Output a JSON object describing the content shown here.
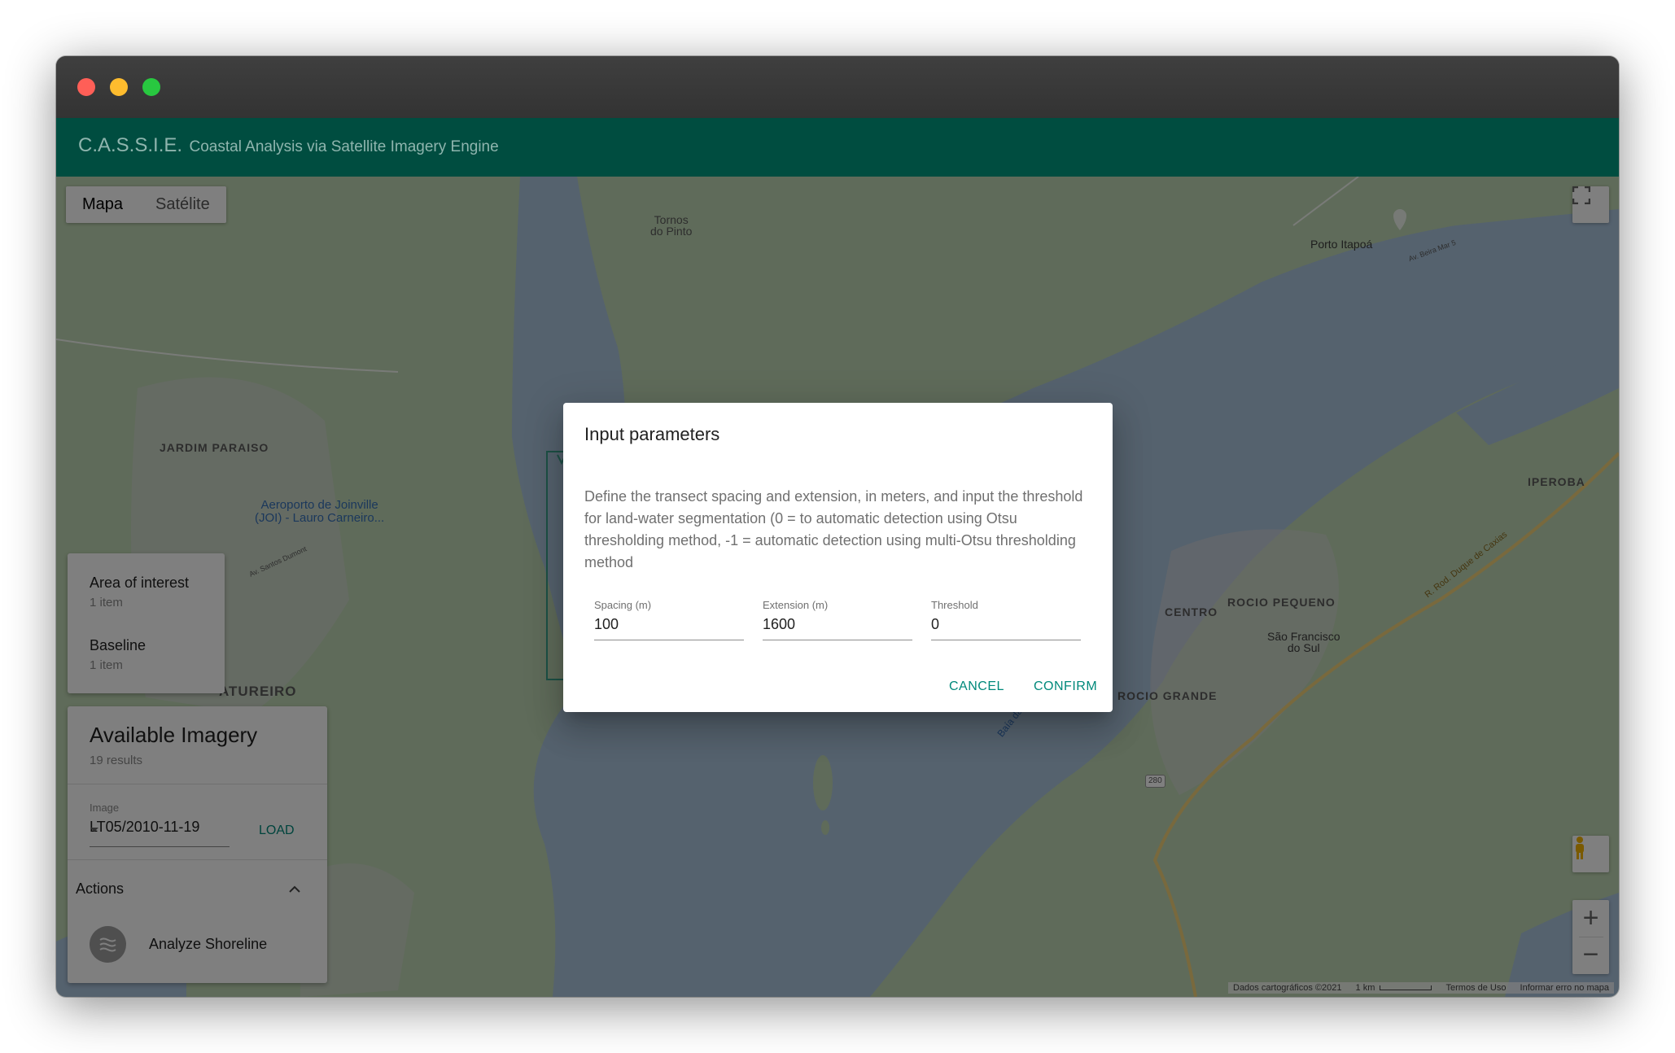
{
  "window": {
    "controls": [
      "close",
      "minimize",
      "maximize"
    ],
    "colors": {
      "close": "#ff5f57",
      "minimize": "#febc2e",
      "maximize": "#28c840"
    }
  },
  "appbar": {
    "title": "C.A.S.S.I.E.",
    "subtitle": "Coastal Analysis via Satellite Imagery Engine",
    "color": "#004d40"
  },
  "map": {
    "type_tabs": [
      {
        "label": "Mapa",
        "active": true
      },
      {
        "label": "Satélite",
        "active": false
      }
    ],
    "labels": {
      "tornos": "Tornos\ndo Pinto",
      "porto": "Porto Itapoá",
      "beira_mar": "Av. Beira Mar 5",
      "jardim": "JARDIM PARAISO",
      "aeroporto": "Aeroporto de Joinville\n(JOI) - Lauro Carneiro...",
      "santos_dumont": "Av. Santos Dumont",
      "iperoba": "IPEROBA",
      "rod_duque": "R. Rod. Duque de Caxias",
      "centro": "CENTRO",
      "rocio_pequeno": "ROCIO PEQUENO",
      "sao_francisco": "São Francisco\ndo Sul",
      "rocio_grande": "ROCIO GRANDE",
      "baia": "Baía da Babitonga",
      "ureiro": "ATUREIRO",
      "route_280": "280"
    },
    "footer": {
      "data": "Dados cartográficos ©2021",
      "scale": "1 km",
      "terms": "Termos de Uso",
      "report": "Informar erro no mapa"
    },
    "zoom_in": "+",
    "zoom_out": "−"
  },
  "layers": [
    {
      "name": "Area of interest",
      "count": "1 item"
    },
    {
      "name": "Baseline",
      "count": "1 item"
    }
  ],
  "imagery": {
    "title": "Available Imagery",
    "results": "19 results",
    "image_label": "Image",
    "image_value": "LT05/2010-11-19",
    "load": "LOAD"
  },
  "actions": {
    "title": "Actions",
    "items": [
      {
        "label": "Analyze Shoreline",
        "icon": "waves-icon"
      }
    ]
  },
  "dialog": {
    "title": "Input parameters",
    "text": "Define the transect spacing and extension, in meters, and input the threshold for land-water segmentation (0 = to automatic detection using Otsu thresholding method, -1 = automatic detection using multi-Otsu thresholding method",
    "fields": [
      {
        "label": "Spacing (m)",
        "value": "100"
      },
      {
        "label": "Extension (m)",
        "value": "1600"
      },
      {
        "label": "Threshold",
        "value": "0"
      }
    ],
    "cancel": "CANCEL",
    "confirm": "CONFIRM",
    "accent": "#00897b"
  }
}
